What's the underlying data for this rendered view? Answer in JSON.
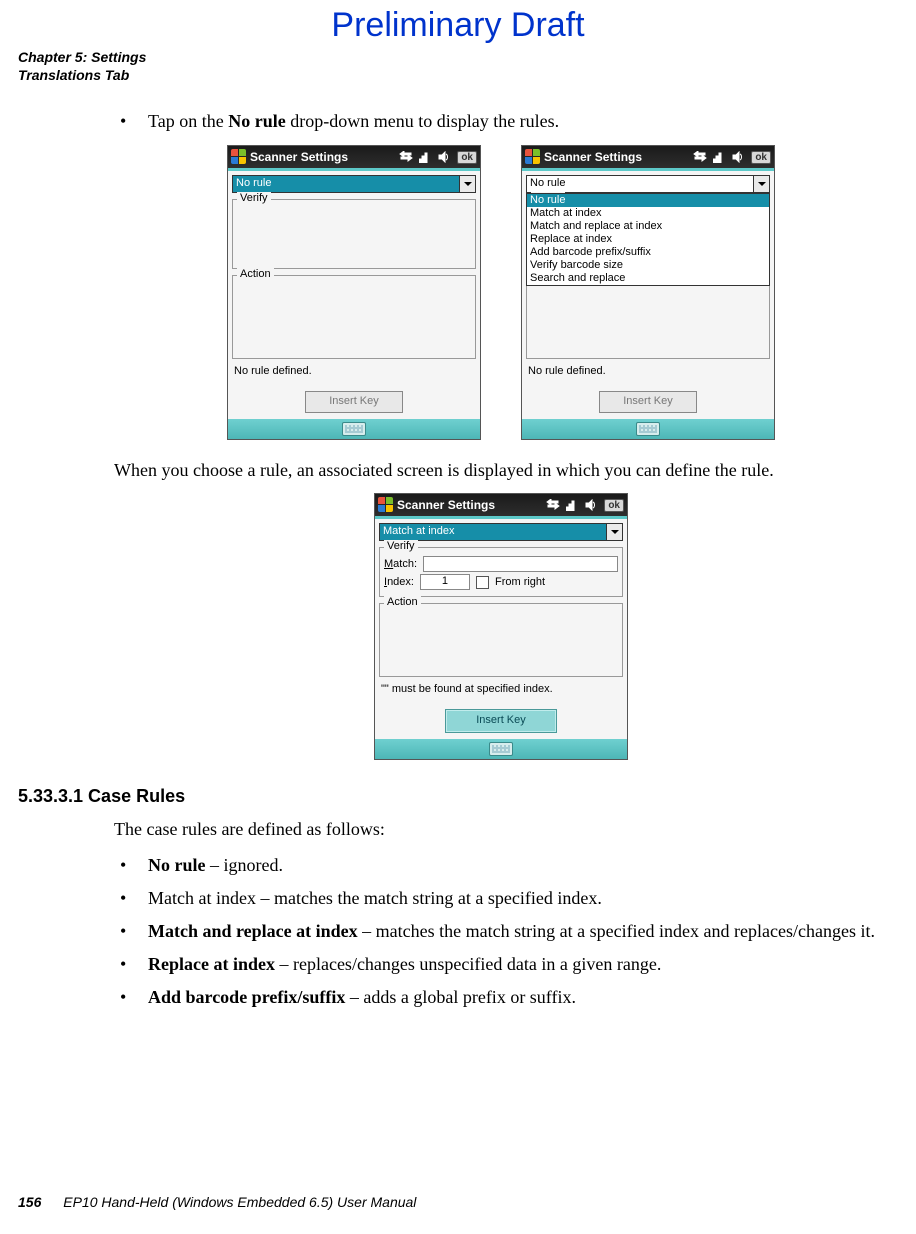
{
  "header": {
    "draft": "Preliminary Draft",
    "chapter_line": "Chapter 5: Settings",
    "section_line": "Translations Tab"
  },
  "intro_bullet": {
    "pre": "Tap on the ",
    "bold": "No rule",
    "post": " drop-down menu to display the rules."
  },
  "screenshots_common": {
    "title": "Scanner Settings",
    "ok": "ok",
    "verify_label": "Verify",
    "action_label": "Action",
    "insert_key": "Insert Key"
  },
  "shot_left": {
    "dropdown_value": "No rule",
    "status": "No rule defined."
  },
  "shot_right": {
    "dropdown_value": "No rule",
    "options": [
      "No rule",
      "Match at index",
      "Match and replace at index",
      "Replace at index",
      "Add barcode prefix/suffix",
      "Verify barcode size",
      "Search and replace"
    ],
    "status": "No rule defined."
  },
  "mid_para": "When you choose a rule, an associated screen is displayed in which you can define the rule.",
  "shot_third": {
    "dropdown_value": "Match at index",
    "match_label": "Match:",
    "index_label": "Index:",
    "index_value": "1",
    "from_right": "From right",
    "status": "\"\" must be found at specified index."
  },
  "section_heading": "5.33.3.1 Case Rules",
  "section_intro": "The case rules are defined as follows:",
  "case_rules": [
    {
      "bold": "No rule",
      "rest": " – ignored."
    },
    {
      "bold": "",
      "plain": "Match at index – matches the match string at a specified index."
    },
    {
      "bold": "Match and replace at index",
      "rest": " – matches the match string at a specified index and replaces/changes it."
    },
    {
      "bold": "Replace at index",
      "rest": " – replaces/changes unspecified data in a given range."
    },
    {
      "bold": "Add barcode prefix/suffix",
      "rest": " – adds a global prefix or suffix."
    }
  ],
  "footer": {
    "page_number": "156",
    "manual": "EP10 Hand-Held (Windows Embedded 6.5) User Manual"
  }
}
